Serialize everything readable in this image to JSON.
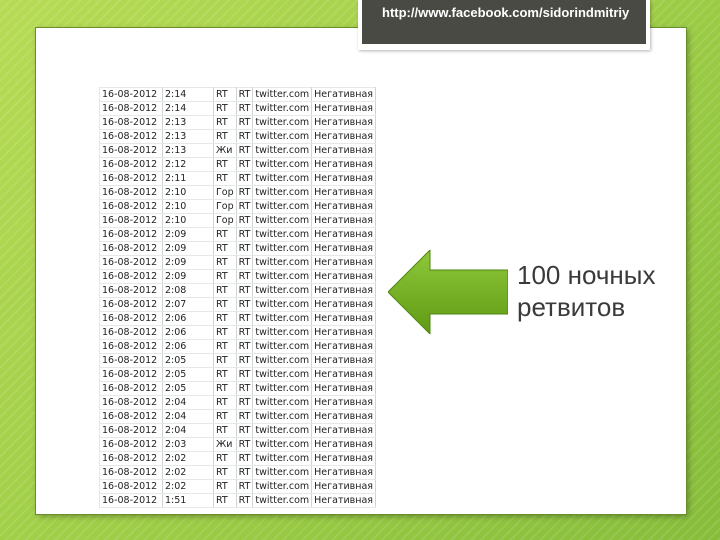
{
  "source_url": "http://www.facebook.com/sidorindmitriy",
  "caption": "100 ночных ретвитов",
  "arrow_color": "#7ab51d",
  "table": {
    "rows": [
      [
        "16-08-2012",
        "2:14",
        "RT",
        "RT",
        "twitter.com",
        "Негативная"
      ],
      [
        "16-08-2012",
        "2:14",
        "RT",
        "RT",
        "twitter.com",
        "Негативная"
      ],
      [
        "16-08-2012",
        "2:13",
        "RT",
        "RT",
        "twitter.com",
        "Негативная"
      ],
      [
        "16-08-2012",
        "2:13",
        "RT",
        "RT",
        "twitter.com",
        "Негативная"
      ],
      [
        "16-08-2012",
        "2:13",
        "Жи",
        "RT",
        "twitter.com",
        "Негативная"
      ],
      [
        "16-08-2012",
        "2:12",
        "RT",
        "RT",
        "twitter.com",
        "Негативная"
      ],
      [
        "16-08-2012",
        "2:11",
        "RT",
        "RT",
        "twitter.com",
        "Негативная"
      ],
      [
        "16-08-2012",
        "2:10",
        "Гор",
        "RT",
        "twitter.com",
        "Негативная"
      ],
      [
        "16-08-2012",
        "2:10",
        "Гор",
        "RT",
        "twitter.com",
        "Негативная"
      ],
      [
        "16-08-2012",
        "2:10",
        "Гор",
        "RT",
        "twitter.com",
        "Негативная"
      ],
      [
        "16-08-2012",
        "2:09",
        "RT",
        "RT",
        "twitter.com",
        "Негативная"
      ],
      [
        "16-08-2012",
        "2:09",
        "RT",
        "RT",
        "twitter.com",
        "Негативная"
      ],
      [
        "16-08-2012",
        "2:09",
        "RT",
        "RT",
        "twitter.com",
        "Негативная"
      ],
      [
        "16-08-2012",
        "2:09",
        "RT",
        "RT",
        "twitter.com",
        "Негативная"
      ],
      [
        "16-08-2012",
        "2:08",
        "RT",
        "RT",
        "twitter.com",
        "Негативная"
      ],
      [
        "16-08-2012",
        "2:07",
        "RT",
        "RT",
        "twitter.com",
        "Негативная"
      ],
      [
        "16-08-2012",
        "2:06",
        "RT",
        "RT",
        "twitter.com",
        "Негативная"
      ],
      [
        "16-08-2012",
        "2:06",
        "RT",
        "RT",
        "twitter.com",
        "Негативная"
      ],
      [
        "16-08-2012",
        "2:06",
        "RT",
        "RT",
        "twitter.com",
        "Негативная"
      ],
      [
        "16-08-2012",
        "2:05",
        "RT",
        "RT",
        "twitter.com",
        "Негативная"
      ],
      [
        "16-08-2012",
        "2:05",
        "RT",
        "RT",
        "twitter.com",
        "Негативная"
      ],
      [
        "16-08-2012",
        "2:05",
        "RT",
        "RT",
        "twitter.com",
        "Негативная"
      ],
      [
        "16-08-2012",
        "2:04",
        "RT",
        "RT",
        "twitter.com",
        "Негативная"
      ],
      [
        "16-08-2012",
        "2:04",
        "RT",
        "RT",
        "twitter.com",
        "Негативная"
      ],
      [
        "16-08-2012",
        "2:04",
        "RT",
        "RT",
        "twitter.com",
        "Негативная"
      ],
      [
        "16-08-2012",
        "2:03",
        "Жи",
        "RT",
        "twitter.com",
        "Негативная"
      ],
      [
        "16-08-2012",
        "2:02",
        "RT",
        "RT",
        "twitter.com",
        "Негативная"
      ],
      [
        "16-08-2012",
        "2:02",
        "RT",
        "RT",
        "twitter.com",
        "Негативная"
      ],
      [
        "16-08-2012",
        "2:02",
        "RT",
        "RT",
        "twitter.com",
        "Негативная"
      ],
      [
        "16-08-2012",
        "1:51",
        "RT",
        "RT",
        "twitter.com",
        "Негативная"
      ]
    ]
  }
}
